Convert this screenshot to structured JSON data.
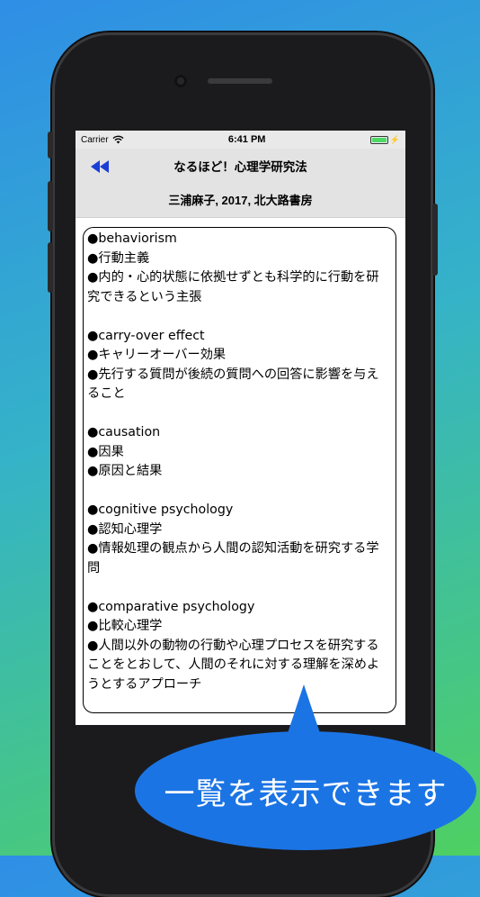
{
  "status_bar": {
    "carrier": "Carrier",
    "time": "6:41 PM"
  },
  "header": {
    "title": "なるほど！心理学研究法",
    "subtitle": "三浦麻子, 2017, 北大路書房"
  },
  "entries": [
    {
      "lines": [
        "●behaviorism",
        "●行動主義",
        "●内的・心的状態に依拠せずとも科学的に行動を研究できるという主張"
      ]
    },
    {
      "lines": [
        "●carry-over effect",
        "●キャリーオーバー効果",
        "●先行する質問が後続の質問への回答に影響を与えること"
      ]
    },
    {
      "lines": [
        "●causation",
        "●因果",
        "●原因と結果"
      ]
    },
    {
      "lines": [
        "●cognitive psychology",
        "●認知心理学",
        "●情報処理の観点から人間の認知活動を研究する学問"
      ]
    },
    {
      "lines": [
        "●comparative psychology",
        "●比較心理学",
        "●人間以外の動物の行動や心理プロセスを研究することをとおして、人間のそれに対する理解を深めようとするアプローチ"
      ]
    }
  ],
  "callout": {
    "text": "一覧を表示できます"
  },
  "colors": {
    "background_top": "#2f8ee6",
    "background_bottom": "#4fd062",
    "callout": "#1b74e4",
    "back_icon": "#1a3fd6"
  }
}
